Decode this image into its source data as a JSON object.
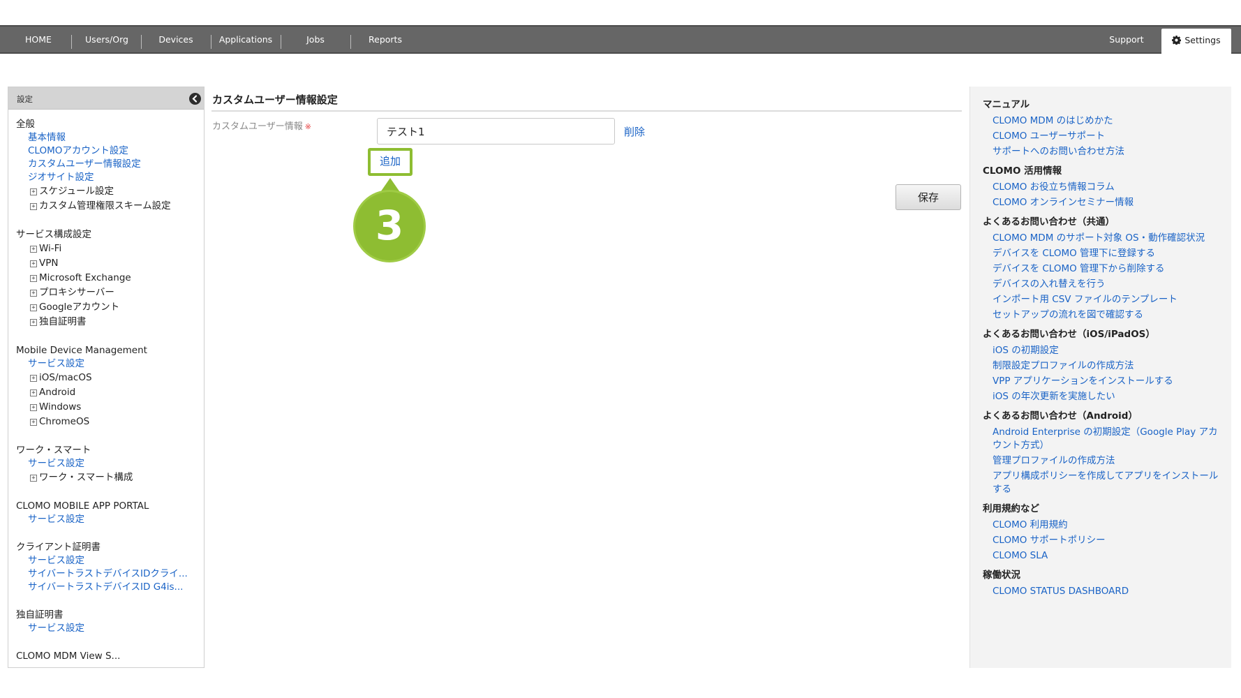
{
  "topnav": {
    "items": [
      "HOME",
      "Users/Org",
      "Devices",
      "Applications",
      "Jobs",
      "Reports"
    ],
    "support": "Support",
    "settings": "Settings"
  },
  "sidebar": {
    "header": "設定",
    "sections": {
      "general": {
        "title": "全般",
        "links": [
          "基本情報",
          "CLOMOアカウント設定",
          "カスタムユーザー情報設定",
          "ジオサイト設定"
        ],
        "expandables": [
          "スケジュール設定",
          "カスタム管理権限スキーム設定"
        ]
      },
      "service_config": {
        "title": "サービス構成設定",
        "expandables": [
          "Wi-Fi",
          "VPN",
          "Microsoft Exchange",
          "プロキシサーバー",
          "Googleアカウント",
          "独自証明書"
        ]
      },
      "mdm": {
        "title": "Mobile Device Management",
        "links": [
          "サービス設定"
        ],
        "expandables": [
          "iOS/macOS",
          "Android",
          "Windows",
          "ChromeOS"
        ]
      },
      "work_smart": {
        "title": "ワーク・スマート",
        "links": [
          "サービス設定"
        ],
        "expandables": [
          "ワーク・スマート構成"
        ]
      },
      "app_portal": {
        "title": "CLOMO MOBILE APP PORTAL",
        "links": [
          "サービス設定"
        ]
      },
      "client_cert": {
        "title": "クライアント証明書",
        "links": [
          "サービス設定",
          "サイバートラストデバイスIDクライ...",
          "サイバートラストデバイスID G4is..."
        ]
      },
      "own_cert": {
        "title": "独自証明書",
        "links": [
          "サービス設定"
        ]
      },
      "cut_off": {
        "title": "CLOMO MDM View S..."
      }
    }
  },
  "main": {
    "title": "カスタムユーザー情報設定",
    "field_label": "カスタムユーザー情報",
    "required_mark": "※",
    "field_value": "テスト1",
    "delete": "削除",
    "add": "追加",
    "save": "保存",
    "step_number": "3",
    "accent_color": "#8ebd32"
  },
  "rightpanel": {
    "sections": [
      {
        "title": "マニュアル",
        "links": [
          "CLOMO MDM のはじめかた",
          "CLOMO ユーザーサポート",
          "サポートへのお問い合わせ方法"
        ]
      },
      {
        "title": "CLOMO 活用情報",
        "links": [
          "CLOMO お役立ち情報コラム",
          "CLOMO オンラインセミナー情報"
        ]
      },
      {
        "title": "よくあるお問い合わせ（共通）",
        "links": [
          "CLOMO MDM のサポート対象 OS・動作確認状況",
          "デバイスを CLOMO 管理下に登録する",
          "デバイスを CLOMO 管理下から削除する",
          "デバイスの入れ替えを行う",
          "インポート用 CSV ファイルのテンプレート",
          "セットアップの流れを図で確認する"
        ]
      },
      {
        "title": "よくあるお問い合わせ（iOS/iPadOS）",
        "links": [
          "iOS の初期設定",
          "制限設定プロファイルの作成方法",
          "VPP アプリケーションをインストールする",
          "iOS の年次更新を実施したい"
        ]
      },
      {
        "title": "よくあるお問い合わせ（Android）",
        "links": [
          "Android Enterprise の初期設定（Google Play アカウント方式）",
          "管理プロファイルの作成方法",
          "アプリ構成ポリシーを作成してアプリをインストールする"
        ]
      },
      {
        "title": "利用規約など",
        "links": [
          "CLOMO 利用規約",
          "CLOMO サポートポリシー",
          "CLOMO SLA"
        ]
      },
      {
        "title": "稼働状況",
        "links": [
          "CLOMO STATUS DASHBOARD"
        ]
      }
    ]
  }
}
